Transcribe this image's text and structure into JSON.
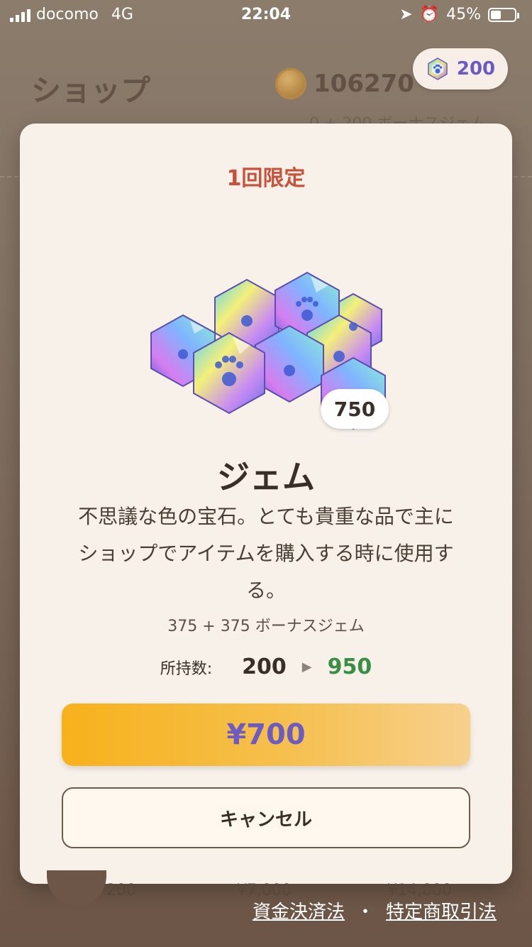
{
  "status_bar": {
    "carrier": "docomo",
    "network": "4G",
    "time": "22:04",
    "battery": "45%",
    "battery_level": 0.45
  },
  "background": {
    "title": "ショップ",
    "coin_value": "106270",
    "bonus_text": "0 + 200 ボーナスジェム",
    "footer_values": [
      "200",
      "¥7,000",
      "¥14,000"
    ]
  },
  "gem_chip": {
    "icon": "gem-paw-icon",
    "value": "200"
  },
  "modal": {
    "limit_label": "1回限定",
    "amount_badge": "750",
    "item_name": "ジェム",
    "item_description": "不思議な色の宝石。とても貴重な品で主にショップでアイテムを購入する時に使用する。",
    "bonus_line": "375 + 375 ボーナスジェム",
    "owned": {
      "label": "所持数:",
      "from": "200",
      "to": "950"
    },
    "buy_label": "¥700",
    "cancel_label": "キャンセル"
  },
  "footer_links": {
    "link1": "資金決済法",
    "separator": "・",
    "link2": "特定商取引法"
  },
  "colors": {
    "accent_red": "#c9513b",
    "gem_purple": "#6d5bc4",
    "owned_green": "#3a8f45",
    "buy_orange": "#f7b11b"
  }
}
